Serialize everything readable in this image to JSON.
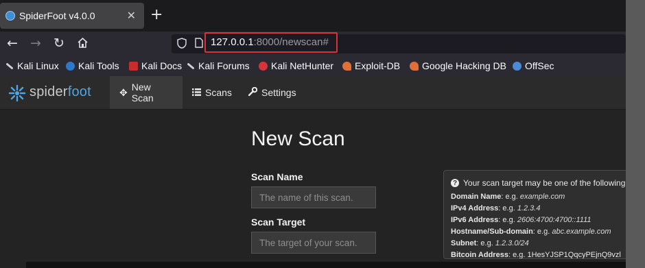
{
  "browser": {
    "tab_title": "SpiderFoot v4.0.0",
    "tab_close_icon": "close-icon",
    "new_tab_icon": "plus-icon",
    "url_host": "127.0.0.1",
    "url_path": ":8000/newscan#",
    "bookmarks": [
      {
        "label": "Kali Linux",
        "color": "#d0d0d0"
      },
      {
        "label": "Kali Tools",
        "color": "#2f78c8"
      },
      {
        "label": "Kali Docs",
        "color": "#c62d2d"
      },
      {
        "label": "Kali Forums",
        "color": "#cfcfcf"
      },
      {
        "label": "Kali NetHunter",
        "color": "#d6333b"
      },
      {
        "label": "Exploit-DB",
        "color": "#e07038"
      },
      {
        "label": "Google Hacking DB",
        "color": "#e07038"
      },
      {
        "label": "OffSec",
        "color": "#4a8ad6"
      }
    ]
  },
  "app": {
    "logo_spider": "spider",
    "logo_foot": "foot",
    "nav": {
      "new_scan": "New Scan",
      "scans": "Scans",
      "settings": "Settings"
    },
    "page_title": "New Scan",
    "scan_name_label": "Scan Name",
    "scan_name_placeholder": "The name of this scan.",
    "scan_target_label": "Scan Target",
    "scan_target_placeholder": "The target of your scan.",
    "help": {
      "intro": "Your scan target may be one of the following. S",
      "rows": [
        {
          "label": "Domain Name",
          "prefix": ": e.g. ",
          "example": "example.com"
        },
        {
          "label": "IPv4 Address",
          "prefix": ": e.g. ",
          "example": "1.2.3.4"
        },
        {
          "label": "IPv6 Address",
          "prefix": ": e.g. ",
          "example": "2606:4700:4700::1111"
        },
        {
          "label": "Hostname/Sub-domain",
          "prefix": ": e.g. ",
          "example": "abc.example.com"
        },
        {
          "label": "Subnet",
          "prefix": ": e.g. ",
          "example": "1.2.3.0/24"
        },
        {
          "label": "Bitcoin Address",
          "prefix": ": e.g. ",
          "example": "1HesYJSP1QqcyPEjnQ9vzl"
        }
      ]
    }
  },
  "colors": {
    "highlight": "#d6333b",
    "app_bg": "#232323",
    "navbar_bg": "#2b2b2b"
  }
}
